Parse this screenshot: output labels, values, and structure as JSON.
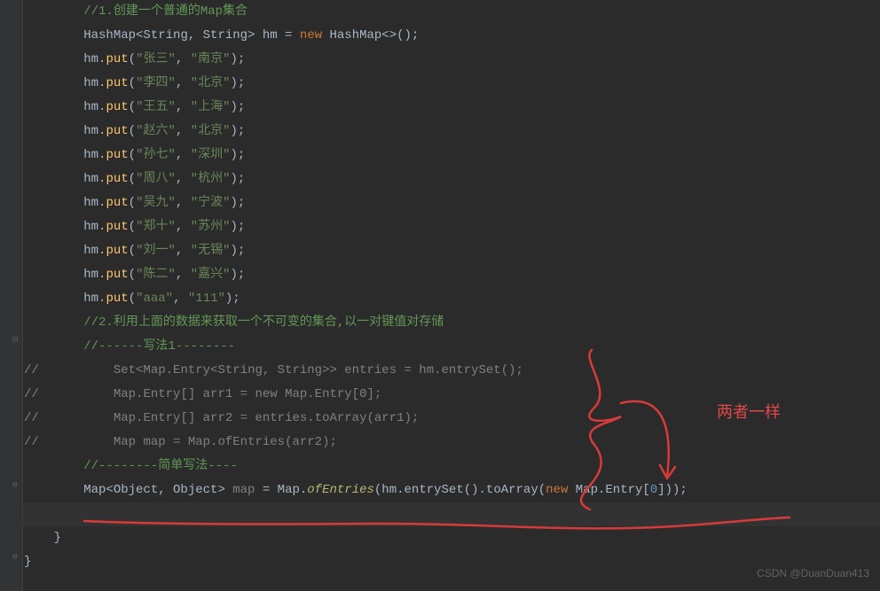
{
  "code": {
    "comment_create": "//1.创建一个普通的Map集合",
    "decl_hm_1": "HashMap",
    "decl_hm_2": "<String, String> hm = ",
    "kw_new": "new",
    "decl_hm_3": " HashMap<>();",
    "puts": [
      {
        "k": "\"张三\"",
        "v": "\"南京\""
      },
      {
        "k": "\"李四\"",
        "v": "\"北京\""
      },
      {
        "k": "\"王五\"",
        "v": "\"上海\""
      },
      {
        "k": "\"赵六\"",
        "v": "\"北京\""
      },
      {
        "k": "\"孙七\"",
        "v": "\"深圳\""
      },
      {
        "k": "\"周八\"",
        "v": "\"杭州\""
      },
      {
        "k": "\"吴九\"",
        "v": "\"宁波\""
      },
      {
        "k": "\"郑十\"",
        "v": "\"苏州\""
      },
      {
        "k": "\"刘一\"",
        "v": "\"无锡\""
      },
      {
        "k": "\"陈二\"",
        "v": "\"嘉兴\""
      },
      {
        "k": "\"aaa\"",
        "v": "\"111\""
      }
    ],
    "comment_get": "//2.利用上面的数据来获取一个不可变的集合,以一对键值对存储",
    "comment_method1": "//------写法1--------",
    "block_comment_prefix": "//",
    "block_l1": "    Set<Map.Entry<String, String>> entries = hm.entrySet();",
    "block_l2": "    Map.Entry[] arr1 = new Map.Entry[0];",
    "block_l3": "    Map.Entry[] arr2 = entries.toArray(arr1);",
    "block_l4": "    Map map = Map.ofEntries(arr2);",
    "comment_simple": "//--------简单写法----",
    "final_1a": "Map<Object, Object> ",
    "final_map_var": "map",
    "final_1b": " = Map.",
    "final_ofEntries": "ofEntries",
    "final_1c": "(hm.entrySet().toArray(",
    "final_1d": " Map.Entry[",
    "final_zero": "0",
    "final_1e": "]));",
    "brace1": "}",
    "brace2": "}",
    "put_method": "put",
    "hm_ident": "hm",
    "dot": ".",
    "sep": ", ",
    "paren_open": "(",
    "paren_close_semi": ");"
  },
  "annotation_text": "两者一样",
  "watermark": "CSDN @DuanDuan413"
}
